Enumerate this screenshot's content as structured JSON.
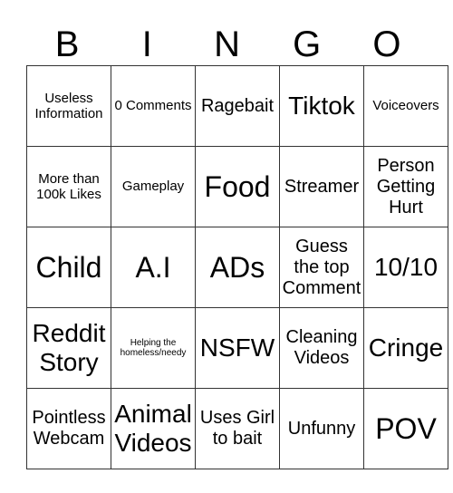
{
  "header": [
    "B",
    "I",
    "N",
    "G",
    "O"
  ],
  "rows": [
    [
      {
        "text": "Useless Information",
        "size": "s-sm"
      },
      {
        "text": "0 Comments",
        "size": "s-sm"
      },
      {
        "text": "Ragebait",
        "size": "s-md"
      },
      {
        "text": "Tiktok",
        "size": "s-lg"
      },
      {
        "text": "Voiceovers",
        "size": "s-sm"
      }
    ],
    [
      {
        "text": "More than 100k Likes",
        "size": "s-sm"
      },
      {
        "text": "Gameplay",
        "size": "s-sm"
      },
      {
        "text": "Food",
        "size": "s-xl"
      },
      {
        "text": "Streamer",
        "size": "s-md"
      },
      {
        "text": "Person Getting Hurt",
        "size": "s-md"
      }
    ],
    [
      {
        "text": "Child",
        "size": "s-xl"
      },
      {
        "text": "A.I",
        "size": "s-xl"
      },
      {
        "text": "ADs",
        "size": "s-xl"
      },
      {
        "text": "Guess the top Comment",
        "size": "s-md"
      },
      {
        "text": "10/10",
        "size": "s-lg"
      }
    ],
    [
      {
        "text": "Reddit Story",
        "size": "s-lg"
      },
      {
        "text": "Helping the homeless/needy",
        "size": "s-xs"
      },
      {
        "text": "NSFW",
        "size": "s-lg"
      },
      {
        "text": "Cleaning Videos",
        "size": "s-md"
      },
      {
        "text": "Cringe",
        "size": "s-lg"
      }
    ],
    [
      {
        "text": "Pointless Webcam",
        "size": "s-md"
      },
      {
        "text": "Animal Videos",
        "size": "s-lg"
      },
      {
        "text": "Uses Girl to bait",
        "size": "s-md"
      },
      {
        "text": "Unfunny",
        "size": "s-md"
      },
      {
        "text": "POV",
        "size": "s-xl"
      }
    ]
  ]
}
